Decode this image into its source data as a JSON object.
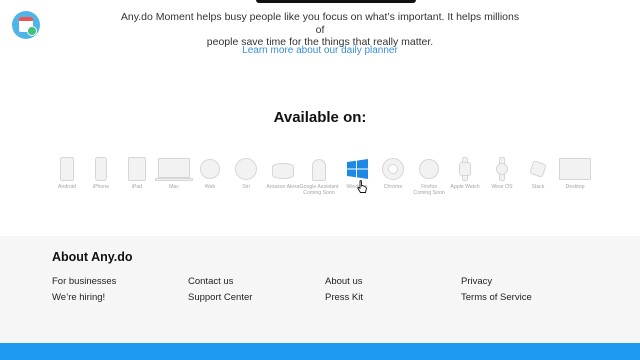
{
  "brand": {
    "logo_icon": "anydo-calendar-check-icon",
    "accent": "#3a8fd8",
    "bar_color": "#1e9bf0"
  },
  "intro": {
    "line1": "Any.do Moment helps busy people like you focus on what’s important. It helps millions of",
    "line2": "people save time for the things that really matter.",
    "learn_more": "Learn more about our daily planner"
  },
  "available": {
    "title": "Available on:",
    "platforms": [
      {
        "label": "Android",
        "icon": "android-phone-icon"
      },
      {
        "label": "iPhone",
        "icon": "iphone-icon"
      },
      {
        "label": "iPad",
        "icon": "ipad-icon"
      },
      {
        "label": "Mac",
        "icon": "mac-laptop-icon"
      },
      {
        "label": "Web",
        "icon": "web-compass-icon"
      },
      {
        "label": "Siri",
        "icon": "siri-icon"
      },
      {
        "label": "Amazon Alexa",
        "icon": "amazon-echo-icon"
      },
      {
        "label": "Google Assistant",
        "sublabel": "Coming Soon",
        "icon": "google-home-icon"
      },
      {
        "label": "Windows",
        "icon": "windows-logo-icon",
        "active": true,
        "color": "#1e88e5"
      },
      {
        "label": "Chrome",
        "icon": "chrome-icon"
      },
      {
        "label": "Firefox",
        "sublabel": "Coming Soon",
        "icon": "firefox-icon"
      },
      {
        "label": "Apple Watch",
        "icon": "apple-watch-icon"
      },
      {
        "label": "Wear OS",
        "icon": "wear-os-watch-icon"
      },
      {
        "label": "Slack",
        "icon": "slack-icon"
      },
      {
        "label": "Desktop",
        "icon": "desktop-monitor-icon"
      }
    ]
  },
  "footer": {
    "title": "About Any.do",
    "links": {
      "businesses": "For businesses",
      "hiring": "We’re hiring!",
      "contact": "Contact us",
      "support": "Support Center",
      "about": "About us",
      "press": "Press Kit",
      "privacy": "Privacy",
      "terms": "Terms of Service"
    }
  }
}
